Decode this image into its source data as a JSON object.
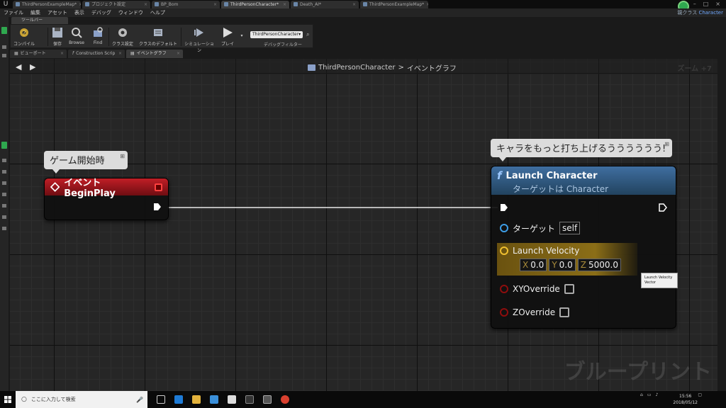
{
  "doc_tabs": [
    "ThirdPersonExampleMap*",
    "プロジェクト設定",
    "BP_Bom",
    "ThirdPersonCharacter*",
    "Death_AI*",
    "ThirdPersonExampleMap*"
  ],
  "menu": [
    "ファイル",
    "編集",
    "アセット",
    "表示",
    "デバッグ",
    "ウィンドウ",
    "ヘルプ"
  ],
  "parent_class": {
    "label": "親クラス",
    "value": "Character"
  },
  "toolbar": {
    "tab_label": "ツールバー",
    "buttons": [
      "コンパイル",
      "保存",
      "Browse",
      "Find",
      "クラス設定",
      "クラスのデフォルト",
      "シミュレーション",
      "プレイ"
    ],
    "debug_object": "ThirdPersonCharacter▾",
    "debug_filter_label": "デバッグフィルター"
  },
  "sub_tabs": [
    "ビューポート",
    "Construction Scrip",
    "イベントグラフ"
  ],
  "graph": {
    "breadcrumb": {
      "class": "ThirdPersonCharacter",
      "sep": ">",
      "graph": "イベントグラフ"
    },
    "zoom": "ズーム +7",
    "watermark": "ブループリント"
  },
  "event_node": {
    "comment": "ゲーム開始時",
    "title": "イベント BeginPlay"
  },
  "launch_node": {
    "comment": "キャラをもっと打ち上げるうううううう!",
    "title": "Launch Character",
    "subtitle": "ターゲットは Character",
    "target_label": "ターゲット",
    "target_value": "self",
    "velocity_label": "Launch Velocity",
    "vx_label": "X",
    "vx": "0.0",
    "vy_label": "Y",
    "vy": "0.0",
    "vz_label": "Z",
    "vz": "5000.0",
    "xy_override_label": "XYOverride",
    "z_override_label": "ZOverride",
    "tooltip_l1": "Launch Velocity",
    "tooltip_l2": "Vector"
  },
  "taskbar": {
    "search_placeholder": "ここに入力して検索",
    "time": "15:56",
    "date": "2018/05/12"
  },
  "colors": {
    "event_header": "#c01e26",
    "function_header": "#3f6ea0",
    "vector_pin": "#f0c030",
    "object_pin": "#3d9de6",
    "bool_pin": "#8e0d0d"
  }
}
